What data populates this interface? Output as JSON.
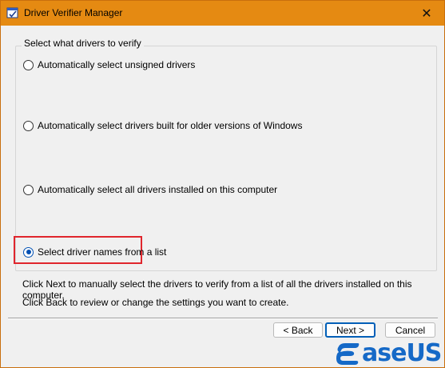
{
  "window": {
    "title": "Driver Verifier Manager",
    "close_glyph": "✕",
    "title_bar_color": "#e58a12"
  },
  "group": {
    "label": "Select what drivers to verify"
  },
  "options": [
    {
      "label": "Automatically select unsigned drivers",
      "selected": false
    },
    {
      "label": "Automatically select drivers built for older versions of Windows",
      "selected": false
    },
    {
      "label": "Automatically select all drivers installed on this computer",
      "selected": false
    },
    {
      "label": "Select driver names from a list",
      "selected": true
    }
  ],
  "info": {
    "line1": "Click Next to manually select the drivers to verify from a list of all the drivers installed on this computer.",
    "line2": "Click Back to review or change the settings you want to create."
  },
  "buttons": {
    "back": "< Back",
    "next": "Next >",
    "cancel": "Cancel"
  },
  "watermark": {
    "brand": "aseUS",
    "brand_color": "#1569c7",
    "highlight_color": "#e0262d"
  },
  "icons": {
    "app": "driver-verifier-icon",
    "close": "close-icon",
    "logo": "easeus-logo-icon"
  }
}
